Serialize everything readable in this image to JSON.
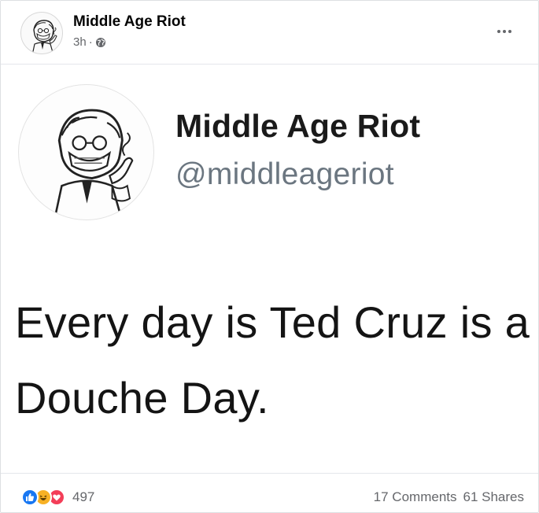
{
  "post": {
    "author_name": "Middle Age Riot",
    "time": "3h",
    "separator": "·",
    "privacy_icon": "globe-icon",
    "more_icon": "more-horizontal-icon"
  },
  "tweet": {
    "name": "Middle Age Riot",
    "handle": "@middleageriot",
    "text": "Every day is Ted Cruz is a Douche Day."
  },
  "footer": {
    "reactions": [
      "like-icon",
      "haha-icon",
      "love-icon"
    ],
    "reaction_count": "497",
    "comments": "17 Comments",
    "shares": "61 Shares"
  },
  "colors": {
    "like": "#1877f2",
    "haha": "#f7b125",
    "love": "#f33e58",
    "secondary_text": "#65676b"
  }
}
